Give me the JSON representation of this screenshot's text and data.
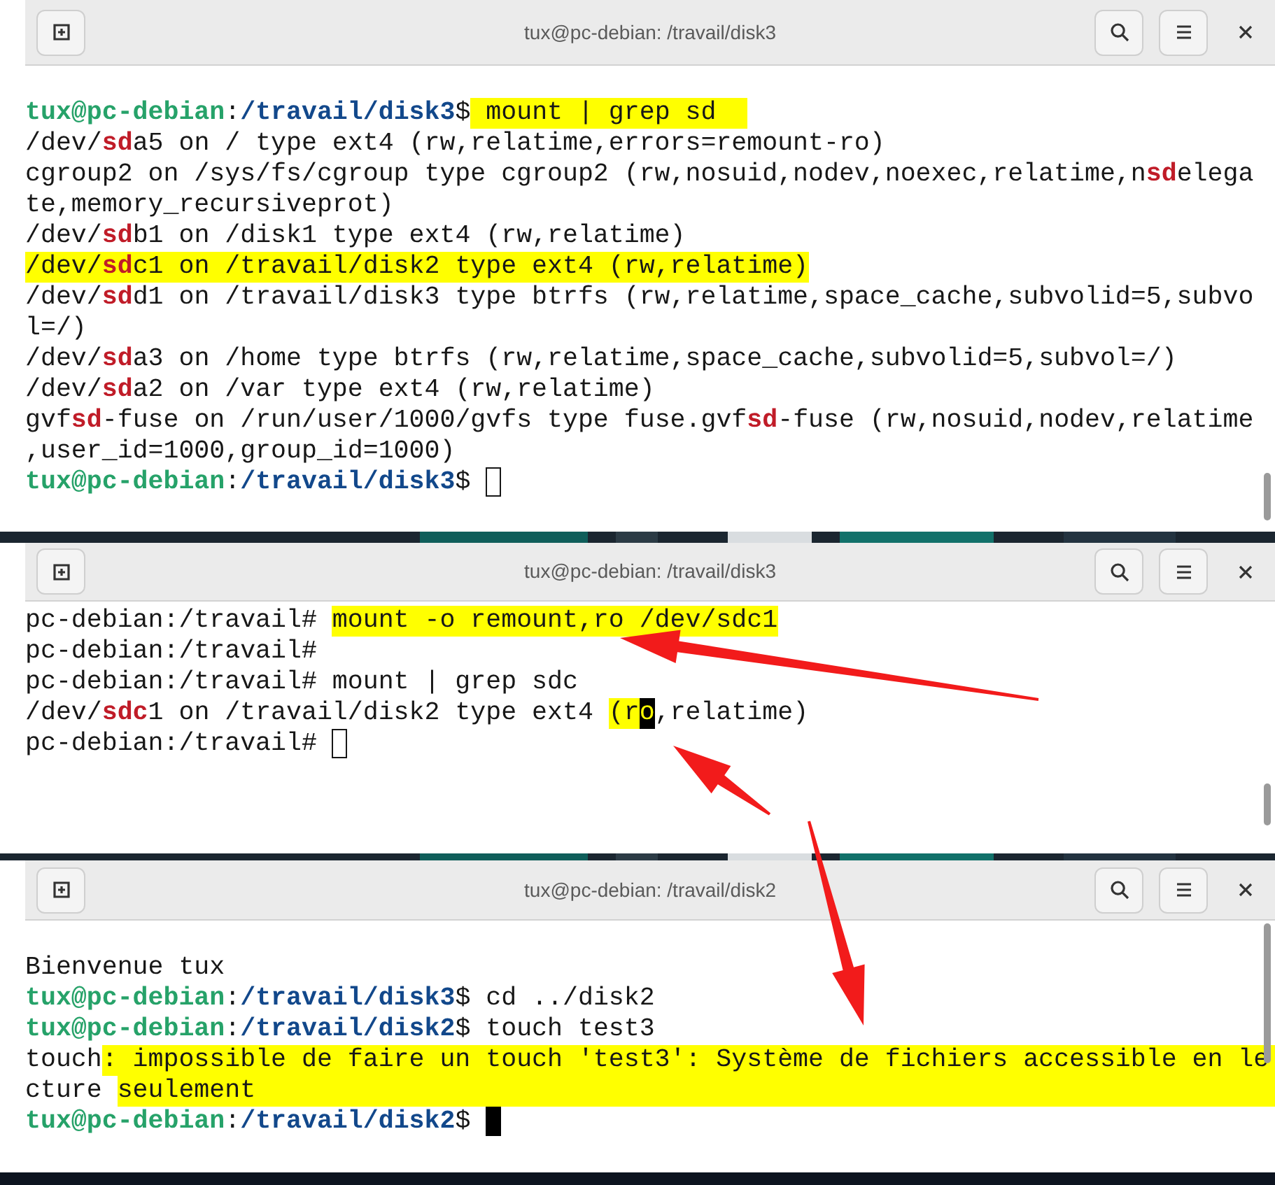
{
  "windows": [
    {
      "title": "tux@pc-debian: /travail/disk3",
      "lines": [
        [
          {
            "text": "tux@pc-debian",
            "kind": "user"
          },
          {
            "text": ":",
            "kind": "plain"
          },
          {
            "text": "/travail/disk3",
            "kind": "path"
          },
          {
            "text": "$",
            "kind": "plain"
          },
          {
            "text": " mount | grep sd  ",
            "kind": "plain",
            "highlight": true
          }
        ],
        [
          {
            "text": "/dev/",
            "kind": "plain"
          },
          {
            "text": "sd",
            "kind": "match"
          },
          {
            "text": "a5 on / type ext4 (rw,relatime,errors=remount-ro)",
            "kind": "plain"
          }
        ],
        [
          {
            "text": "cgroup2 on /sys/fs/cgroup type cgroup2 (rw,nosuid,nodev,noexec,relatime,n",
            "kind": "plain"
          },
          {
            "text": "sd",
            "kind": "match"
          },
          {
            "text": "elega",
            "kind": "plain"
          }
        ],
        [
          {
            "text": "te,memory_recursiveprot)",
            "kind": "plain"
          }
        ],
        [
          {
            "text": "/dev/",
            "kind": "plain"
          },
          {
            "text": "sd",
            "kind": "match"
          },
          {
            "text": "b1 on /disk1 type ext4 (rw,relatime)",
            "kind": "plain"
          }
        ],
        [
          {
            "text": "/dev/",
            "kind": "plain",
            "highlight": true
          },
          {
            "text": "sd",
            "kind": "match",
            "highlight": true
          },
          {
            "text": "c1 on /travail/disk2 type ext4 (rw,relatime)",
            "kind": "plain",
            "highlight": true
          }
        ],
        [
          {
            "text": "/dev/",
            "kind": "plain"
          },
          {
            "text": "sd",
            "kind": "match"
          },
          {
            "text": "d1 on /travail/disk3 type btrfs (rw,relatime,space_cache,subvolid=5,subvo",
            "kind": "plain"
          }
        ],
        [
          {
            "text": "l=/)",
            "kind": "plain"
          }
        ],
        [
          {
            "text": "/dev/",
            "kind": "plain"
          },
          {
            "text": "sd",
            "kind": "match"
          },
          {
            "text": "a3 on /home type btrfs (rw,relatime,space_cache,subvolid=5,subvol=/)",
            "kind": "plain"
          }
        ],
        [
          {
            "text": "/dev/",
            "kind": "plain"
          },
          {
            "text": "sd",
            "kind": "match"
          },
          {
            "text": "a2 on /var type ext4 (rw,relatime)",
            "kind": "plain"
          }
        ],
        [
          {
            "text": "gvf",
            "kind": "plain"
          },
          {
            "text": "sd",
            "kind": "match"
          },
          {
            "text": "-fuse on /run/user/1000/gvfs type fuse.gvf",
            "kind": "plain"
          },
          {
            "text": "sd",
            "kind": "match"
          },
          {
            "text": "-fuse (rw,nosuid,nodev,relatime",
            "kind": "plain"
          }
        ],
        [
          {
            "text": ",user_id=1000,group_id=1000)",
            "kind": "plain"
          }
        ],
        [
          {
            "text": "tux@pc-debian",
            "kind": "user"
          },
          {
            "text": ":",
            "kind": "plain"
          },
          {
            "text": "/travail/disk3",
            "kind": "path"
          },
          {
            "text": "$ ",
            "kind": "plain"
          },
          {
            "kind": "cursor",
            "filled": false
          }
        ]
      ]
    },
    {
      "title": "tux@pc-debian: /travail/disk3",
      "lines": [
        [
          {
            "text": "pc-debian:/travail# ",
            "kind": "plain"
          },
          {
            "text": "mount -o remount,ro /dev/sdc1",
            "kind": "plain",
            "highlight": true
          }
        ],
        [
          {
            "text": "pc-debian:/travail#",
            "kind": "plain"
          }
        ],
        [
          {
            "text": "pc-debian:/travail# mount | grep sdc",
            "kind": "plain"
          }
        ],
        [
          {
            "text": "/dev/",
            "kind": "plain"
          },
          {
            "text": "sdc",
            "kind": "match"
          },
          {
            "text": "1 on /travail/disk2 type ext4 ",
            "kind": "plain"
          },
          {
            "text": "(r",
            "kind": "plain",
            "highlight": true
          },
          {
            "text": "o",
            "kind": "inverse"
          },
          {
            "text": ",relatime)",
            "kind": "plain"
          }
        ],
        [
          {
            "text": "pc-debian:/travail# ",
            "kind": "plain"
          },
          {
            "kind": "cursor",
            "filled": false
          }
        ]
      ]
    },
    {
      "title": "tux@pc-debian: /travail/disk2",
      "lines": [
        [
          {
            "text": "Bienvenue tux",
            "kind": "plain"
          }
        ],
        [
          {
            "text": "tux@pc-debian",
            "kind": "user"
          },
          {
            "text": ":",
            "kind": "plain"
          },
          {
            "text": "/travail/disk3",
            "kind": "path"
          },
          {
            "text": "$ cd ../disk2",
            "kind": "plain"
          }
        ],
        [
          {
            "text": "tux@pc-debian",
            "kind": "user"
          },
          {
            "text": ":",
            "kind": "plain"
          },
          {
            "text": "/travail/disk2",
            "kind": "path"
          },
          {
            "text": "$ touch test3",
            "kind": "plain"
          }
        ],
        [
          {
            "text": "touch",
            "kind": "plain"
          },
          {
            "text": ": impossible de faire un touch 'test3': Système de fichiers accessible en le",
            "kind": "plain",
            "highlight": true,
            "extends": true
          }
        ],
        [
          {
            "text": "cture ",
            "kind": "plain"
          },
          {
            "text": "seulement",
            "kind": "plain",
            "highlight": true,
            "extends": true
          }
        ],
        [
          {
            "text": "tux@pc-debian",
            "kind": "user"
          },
          {
            "text": ":",
            "kind": "plain"
          },
          {
            "text": "/travail/disk2",
            "kind": "path"
          },
          {
            "text": "$ ",
            "kind": "plain"
          },
          {
            "kind": "cursor",
            "filled": true
          }
        ]
      ]
    }
  ]
}
